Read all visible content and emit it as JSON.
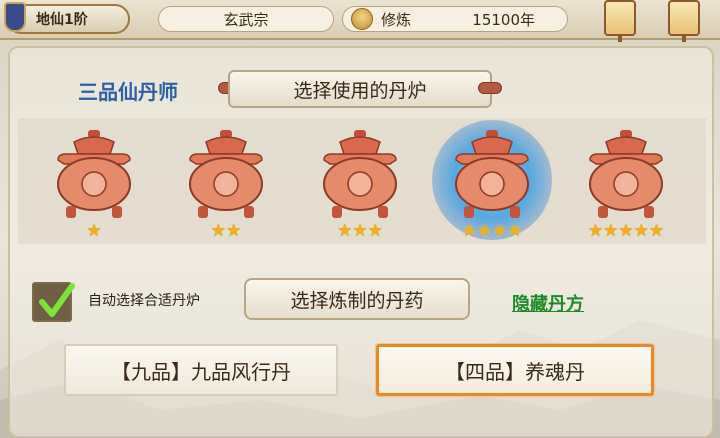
{
  "header": {
    "rank": "地仙1阶",
    "sect": "玄武宗",
    "cultivation_label": "修炼",
    "cultivation_years": "15100年"
  },
  "alchemy": {
    "master_title": "三品仙丹师",
    "furnace_banner": "选择使用的丹炉",
    "furnaces": [
      {
        "stars": 1,
        "selected": false
      },
      {
        "stars": 2,
        "selected": false
      },
      {
        "stars": 3,
        "selected": false
      },
      {
        "stars": 4,
        "selected": true
      },
      {
        "stars": 5,
        "selected": false
      }
    ],
    "auto_select_label": "自动选择合适丹炉",
    "auto_select_checked": true,
    "potion_banner": "选择炼制的丹药",
    "hide_recipes_link": "隐藏丹方",
    "recipes": [
      {
        "label": "【九品】九品风行丹",
        "selected": false
      },
      {
        "label": "【四品】养魂丹",
        "selected": true
      }
    ]
  },
  "colors": {
    "accent": "#e88a2c",
    "master_title": "#2d5fa6",
    "link": "#1f8a2a",
    "star": "#f3b01d"
  },
  "icons": {
    "cultivation": "meditating-figure-icon",
    "furnace": "alchemy-furnace-icon",
    "star": "star-icon",
    "check": "checkmark-icon",
    "lantern": "lantern-icon"
  }
}
